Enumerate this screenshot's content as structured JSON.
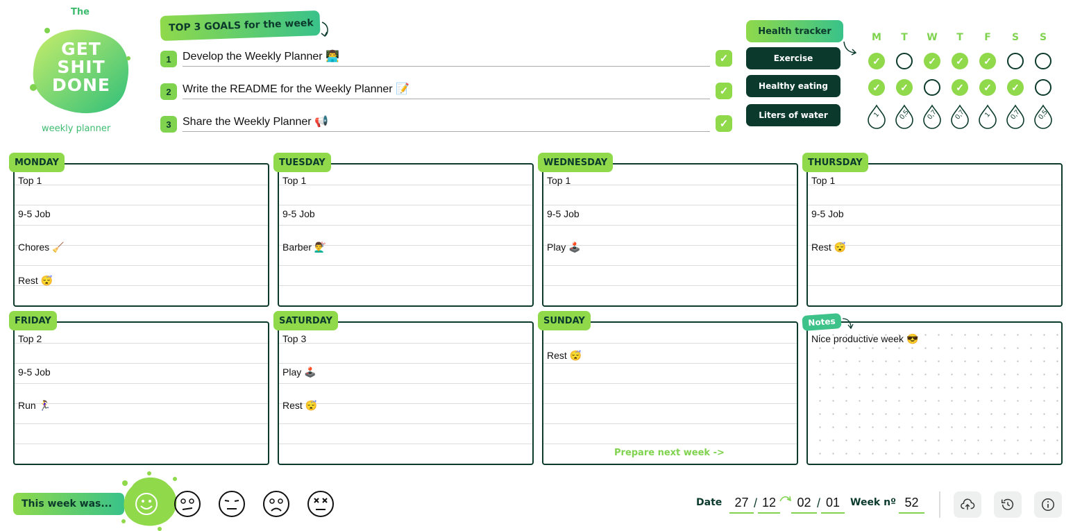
{
  "logo": {
    "the": "The",
    "title_lines": [
      "GET",
      "SHIT",
      "DONE"
    ],
    "subtitle": "weekly planner"
  },
  "goals": {
    "heading": "TOP 3 GOALS for the week",
    "items": [
      {
        "num": "1",
        "text": "Develop the Weekly Planner 👨‍💻",
        "done": true
      },
      {
        "num": "2",
        "text": "Write the README for the Weekly Planner 📝",
        "done": true
      },
      {
        "num": "3",
        "text": "Share the Weekly Planner 📢",
        "done": true
      }
    ]
  },
  "health": {
    "heading": "Health tracker",
    "days": [
      "M",
      "T",
      "W",
      "T",
      "F",
      "S",
      "S"
    ],
    "exercise_label": "Exercise",
    "eating_label": "Healthy eating",
    "water_label": "Liters of water",
    "exercise": [
      true,
      false,
      true,
      true,
      true,
      false,
      false
    ],
    "eating": [
      true,
      true,
      false,
      true,
      true,
      true,
      false
    ],
    "water": [
      "1",
      "0,5",
      "0,7",
      "0,7",
      "1",
      "0,7",
      "0,5"
    ]
  },
  "days": [
    {
      "name": "MONDAY",
      "entries": [
        "Top 1",
        "",
        "9-5 Job",
        "",
        "Chores 🧹",
        "",
        "Rest 😴"
      ]
    },
    {
      "name": "TUESDAY",
      "entries": [
        "Top 1",
        "",
        "9-5 Job",
        "",
        "Barber 💇‍♂️"
      ]
    },
    {
      "name": "WEDNESDAY",
      "entries": [
        "Top 1",
        "",
        "9-5 Job",
        "",
        "Play 🕹️"
      ]
    },
    {
      "name": "THURSDAY",
      "entries": [
        "Top 1",
        "",
        "9-5 Job",
        "",
        "Rest 😴"
      ]
    },
    {
      "name": "FRIDAY",
      "entries": [
        "Top 2",
        "",
        "9-5 Job",
        "",
        "Run 🏃‍♀️"
      ]
    },
    {
      "name": "SATURDAY",
      "entries": [
        "Top 3",
        "",
        "Play 🕹️",
        "",
        "Rest 😴"
      ]
    },
    {
      "name": "SUNDAY",
      "entries": [
        "",
        "Rest 😴"
      ]
    }
  ],
  "prepare_next_week": "Prepare next week ->",
  "notes": {
    "label": "Notes",
    "text": "Nice productive week 😎"
  },
  "mood": {
    "label": "This week was...",
    "selected": "happy",
    "options": [
      "happy",
      "neutral",
      "meh",
      "sad",
      "dead"
    ]
  },
  "date": {
    "label": "Date",
    "from_day": "27",
    "from_month": "12",
    "to_day": "02",
    "to_month": "01",
    "week_label": "Week nº",
    "week": "52"
  },
  "colors": {
    "accent": "#8fd94b",
    "accent2": "#39c28a",
    "dark": "#0b3a2c"
  },
  "actions": [
    "cloud-upload-icon",
    "history-icon",
    "info-icon"
  ]
}
